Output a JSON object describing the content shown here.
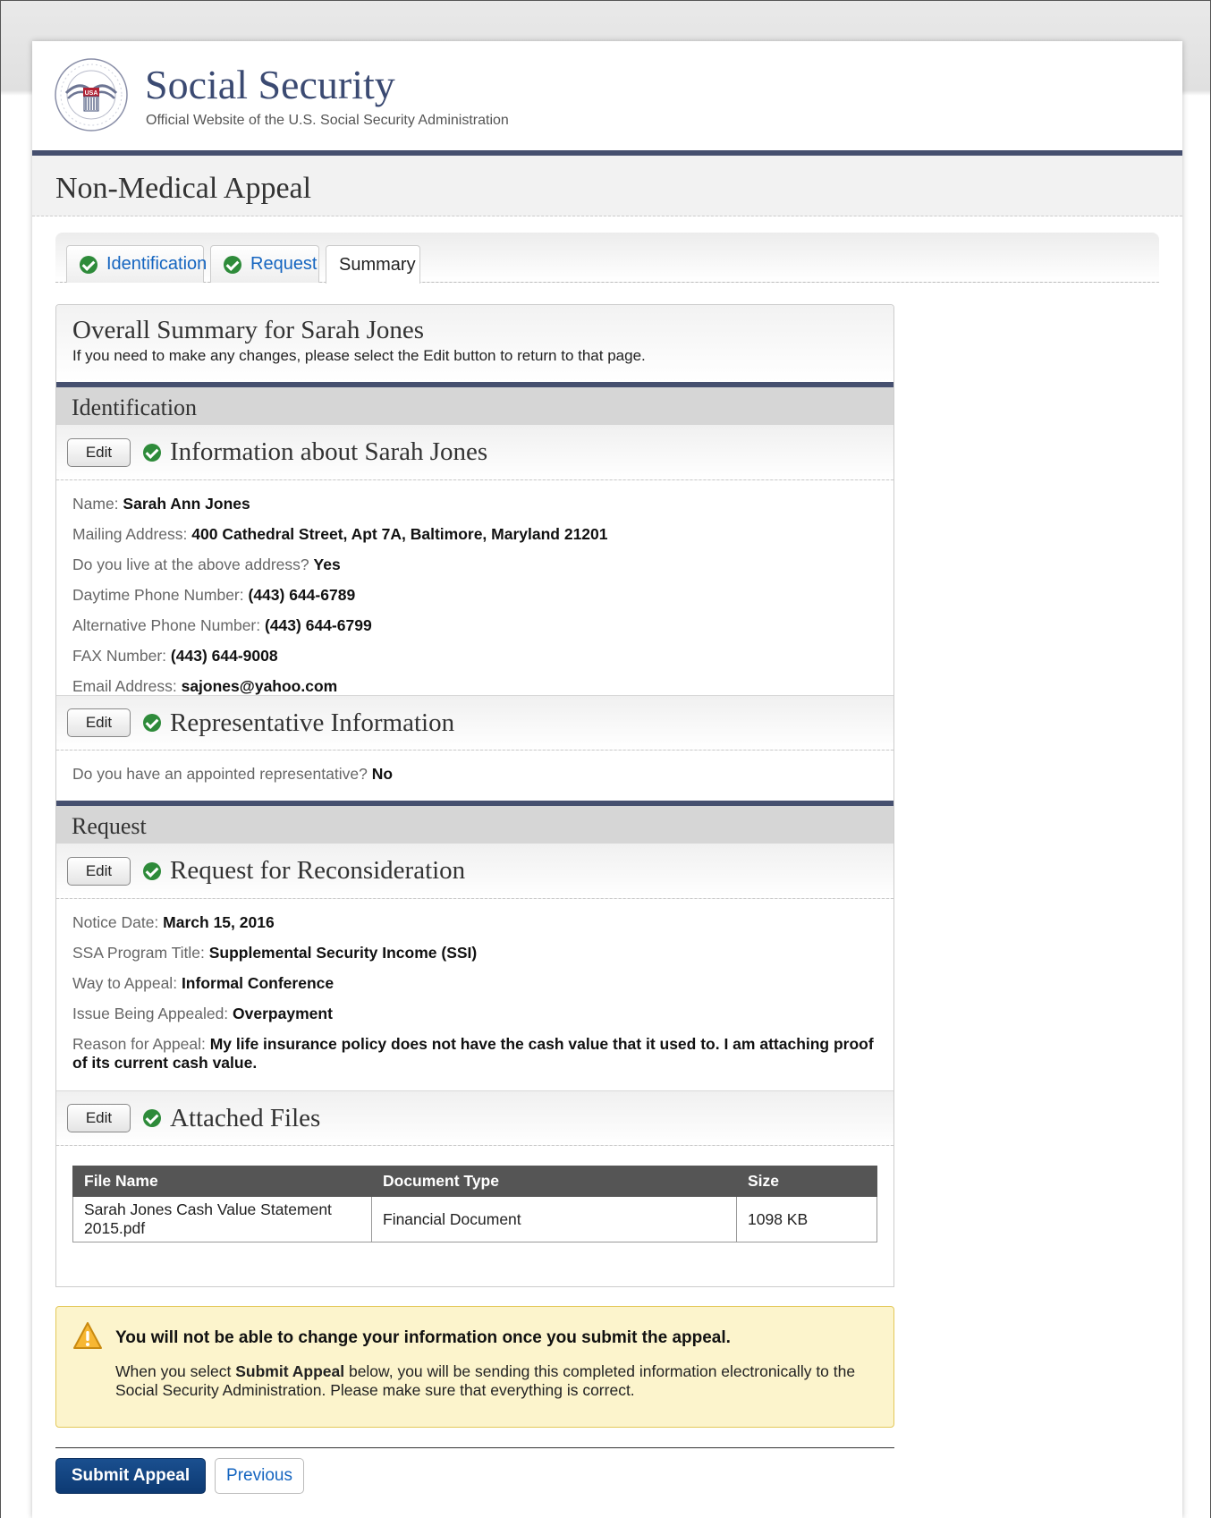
{
  "header": {
    "brand_title": "Social Security",
    "brand_subtitle": "Official Website of the U.S. Social Security Administration"
  },
  "page_title": "Non-Medical Appeal",
  "tabs": [
    {
      "label": "Identification",
      "completed": true,
      "active": false
    },
    {
      "label": "Request",
      "completed": true,
      "active": false
    },
    {
      "label": "Summary",
      "completed": false,
      "active": true
    }
  ],
  "summary": {
    "title": "Overall Summary for Sarah Jones",
    "description": "If you need to make any changes, please select the Edit button to return to that page."
  },
  "edit_label": "Edit",
  "identification": {
    "section_label": "Identification",
    "info": {
      "title": "Information about Sarah Jones",
      "fields": [
        {
          "label": "Name:",
          "value": "Sarah Ann Jones"
        },
        {
          "label": "Mailing Address:",
          "value": "400 Cathedral Street, Apt 7A, Baltimore, Maryland 21201"
        },
        {
          "label": "Do you live at the above address?",
          "value": "Yes"
        },
        {
          "label": "Daytime Phone Number:",
          "value": "(443) 644-6789"
        },
        {
          "label": "Alternative Phone Number:",
          "value": "(443) 644-6799"
        },
        {
          "label": "FAX Number:",
          "value": "(443) 644-9008"
        },
        {
          "label": "Email Address:",
          "value": "sajones@yahoo.com"
        }
      ]
    },
    "representative": {
      "title": "Representative Information",
      "fields": [
        {
          "label": "Do you have an appointed representative?",
          "value": "No"
        }
      ]
    }
  },
  "request": {
    "section_label": "Request",
    "reconsideration": {
      "title": "Request for Reconsideration",
      "fields": [
        {
          "label": "Notice Date:",
          "value": "March 15, 2016"
        },
        {
          "label": "SSA Program Title:",
          "value": "Supplemental Security Income (SSI)"
        },
        {
          "label": "Way to Appeal:",
          "value": "Informal Conference"
        },
        {
          "label": "Issue Being Appealed:",
          "value": "Overpayment"
        },
        {
          "label": "Reason for Appeal:",
          "value": "My life insurance policy does not have the cash value that it used to. I am attaching proof of its current cash value."
        }
      ]
    },
    "files": {
      "title": "Attached Files",
      "columns": [
        "File Name",
        "Document Type",
        "Size"
      ],
      "rows": [
        [
          "Sarah Jones Cash Value Statement 2015.pdf",
          "Financial Document",
          "1098 KB"
        ]
      ]
    }
  },
  "warning": {
    "title": "You will not be able to change your information once you submit the appeal.",
    "body_prefix": "When you select ",
    "body_bold": "Submit Appeal",
    "body_suffix": " below, you will be sending this completed information electronically to the Social Security Administration. Please make sure that everything is correct."
  },
  "actions": {
    "submit_label": "Submit Appeal",
    "previous_label": "Previous"
  },
  "colors": {
    "brand_navy": "#46506f",
    "check_green": "#2e8b3a",
    "link_blue": "#1565c0",
    "submit_blue": "#0d3a73",
    "warning_bg": "#fcf4cc"
  }
}
